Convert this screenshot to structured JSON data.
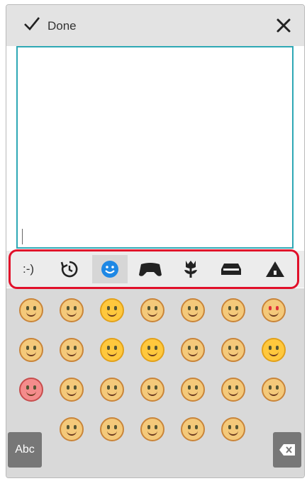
{
  "header": {
    "done_label": "Done"
  },
  "category_bar": {
    "tabs": [
      {
        "name": "emoticon",
        "label": ":-)"
      },
      {
        "name": "recent",
        "icon": "history-icon"
      },
      {
        "name": "smileys",
        "icon": "smiley-icon"
      },
      {
        "name": "games",
        "icon": "gamepad-icon"
      },
      {
        "name": "nature",
        "icon": "flower-icon"
      },
      {
        "name": "travel",
        "icon": "car-icon"
      },
      {
        "name": "symbols",
        "icon": "triangle-icon"
      }
    ],
    "active_index": 2
  },
  "keyboard": {
    "abc_label": "Abc"
  },
  "colors": {
    "accent": "#2ea8b5",
    "highlight": "#e1102a",
    "active_tab_icon": "#1e88e5"
  }
}
